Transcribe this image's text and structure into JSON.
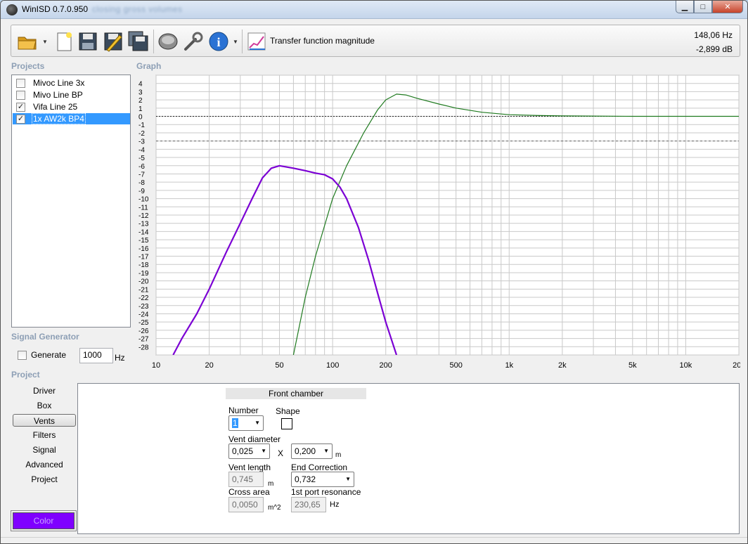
{
  "window": {
    "title": "WinISD 0.7.0.950",
    "title_blurred": "closing gross volumes",
    "controls": {
      "minimize": "▁",
      "maximize": "□",
      "close": "✕"
    }
  },
  "toolbar": {
    "icons": [
      "open-folder-icon",
      "new-document-icon",
      "save-icon",
      "save-as-icon",
      "save-all-icon",
      "driver-icon",
      "settings-wrench-icon",
      "info-icon",
      "graph-icon"
    ],
    "graph_label": "Transfer function magnitude",
    "readout_hz": "148,06 Hz",
    "readout_db": "-2,899 dB"
  },
  "projects": {
    "label": "Projects",
    "items": [
      {
        "label": "Mivoc Line 3x",
        "checked": false,
        "selected": false
      },
      {
        "label": "Mivo Line BP",
        "checked": false,
        "selected": false
      },
      {
        "label": "Vifa Line 25",
        "checked": true,
        "selected": false
      },
      {
        "label": "1x AW2k BP4",
        "checked": true,
        "selected": true
      }
    ]
  },
  "graph": {
    "label": "Graph"
  },
  "signal_generator": {
    "label": "Signal Generator",
    "generate_label": "Generate",
    "generate_checked": false,
    "frequency": "1000",
    "unit": "Hz"
  },
  "project_nav": {
    "label": "Project",
    "items": [
      "Driver",
      "Box",
      "Vents",
      "Filters",
      "Signal",
      "Advanced",
      "Project"
    ],
    "active": "Vents",
    "color_button": "Color",
    "color_value": "#7f00ff"
  },
  "vents_panel": {
    "header": "Front chamber",
    "number_label": "Number",
    "number_value": "1",
    "shape_label": "Shape",
    "vent_diameter_label": "Vent diameter",
    "vent_diameter_value": "0,025",
    "times": "X",
    "vent_height_value": "0,200",
    "diameter_unit": "m",
    "vent_length_label": "Vent length",
    "vent_length_value": "0,745",
    "vent_length_unit": "m",
    "end_correction_label": "End Correction",
    "end_correction_value": "0,732",
    "cross_area_label": "Cross area",
    "cross_area_value": "0,0050",
    "cross_area_unit": "m^2",
    "port_resonance_label": "1st port resonance",
    "port_resonance_value": "230,65",
    "port_resonance_unit": "Hz"
  },
  "chart_data": {
    "type": "line",
    "x_scale": "log",
    "xlim": [
      10,
      20000
    ],
    "ylim": [
      -29,
      5
    ],
    "x_ticks": [
      {
        "v": 10,
        "label": "10"
      },
      {
        "v": 20,
        "label": "20"
      },
      {
        "v": 50,
        "label": "50"
      },
      {
        "v": 100,
        "label": "100"
      },
      {
        "v": 200,
        "label": "200"
      },
      {
        "v": 500,
        "label": "500"
      },
      {
        "v": 1000,
        "label": "1k"
      },
      {
        "v": 2000,
        "label": "2k"
      },
      {
        "v": 5000,
        "label": "5k"
      },
      {
        "v": 10000,
        "label": "10k"
      },
      {
        "v": 20000,
        "label": "20k"
      }
    ],
    "y_ticks": [
      4,
      3,
      2,
      1,
      0,
      -1,
      -2,
      -3,
      -4,
      -5,
      -6,
      -7,
      -8,
      -9,
      -10,
      -11,
      -12,
      -13,
      -14,
      -15,
      -16,
      -17,
      -18,
      -19,
      -20,
      -21,
      -22,
      -23,
      -24,
      -25,
      -26,
      -27,
      -28
    ],
    "reference_lines": [
      {
        "y": 0,
        "style": "dotted-dark"
      },
      {
        "y": -3,
        "style": "dotted-light"
      }
    ],
    "grid": true,
    "series": [
      {
        "color": "#1f7a1f",
        "points": [
          [
            60,
            -29
          ],
          [
            70,
            -22
          ],
          [
            80,
            -17
          ],
          [
            100,
            -10
          ],
          [
            120,
            -6
          ],
          [
            150,
            -2
          ],
          [
            180,
            0.8
          ],
          [
            200,
            2
          ],
          [
            230,
            2.7
          ],
          [
            260,
            2.6
          ],
          [
            300,
            2.2
          ],
          [
            400,
            1.5
          ],
          [
            500,
            1.0
          ],
          [
            700,
            0.5
          ],
          [
            1000,
            0.2
          ],
          [
            1500,
            0.1
          ],
          [
            2000,
            0.05
          ],
          [
            5000,
            0
          ],
          [
            20000,
            0
          ]
        ]
      },
      {
        "color": "#7b00d4",
        "points": [
          [
            12.5,
            -29
          ],
          [
            14,
            -27
          ],
          [
            17,
            -24
          ],
          [
            20,
            -21
          ],
          [
            25,
            -16.5
          ],
          [
            30,
            -13
          ],
          [
            35,
            -10
          ],
          [
            40,
            -7.5
          ],
          [
            45,
            -6.3
          ],
          [
            50,
            -6.0
          ],
          [
            60,
            -6.3
          ],
          [
            70,
            -6.6
          ],
          [
            80,
            -6.9
          ],
          [
            90,
            -7.1
          ],
          [
            100,
            -7.6
          ],
          [
            110,
            -8.6
          ],
          [
            120,
            -10
          ],
          [
            140,
            -13.5
          ],
          [
            160,
            -17.5
          ],
          [
            180,
            -21.5
          ],
          [
            200,
            -25
          ],
          [
            230,
            -29
          ]
        ]
      }
    ]
  }
}
